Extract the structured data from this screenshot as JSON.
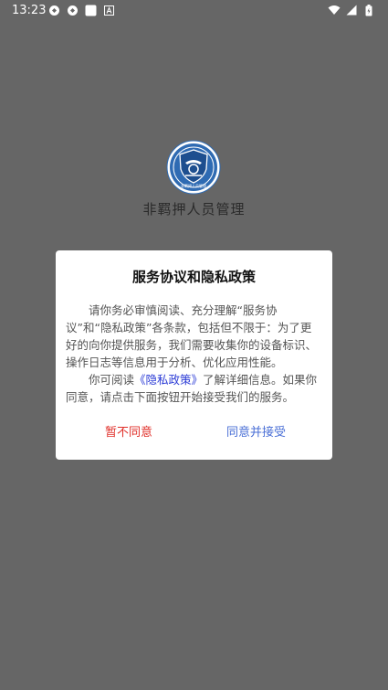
{
  "status_bar": {
    "time": "13:23",
    "left_icons": [
      "sync-icon",
      "sync-icon",
      "square-app-icon",
      "font-icon"
    ],
    "right_icons": [
      "wifi-icon",
      "signal-icon",
      "battery-icon"
    ]
  },
  "app": {
    "name": "非羁押人员管理",
    "logo_text": "非羁押人员管理"
  },
  "dialog": {
    "title": "服务协议和隐私政策",
    "paragraph1": "请你务必审慎阅读、充分理解“服务协议”和“隐私政策”各条款，包括但不限于：为了更好的向你提供服务，我们需要收集你的设备标识、操作日志等信息用于分析、优化应用性能。",
    "paragraph2_prefix": "你可阅读",
    "policy_link": "《隐私政策》",
    "paragraph2_suffix": "了解详细信息。如果你同意，请点击下面按钮开始接受我们的服务。",
    "disagree_label": "暂不同意",
    "agree_label": "同意并接受"
  },
  "colors": {
    "overlay_bg": "#666666",
    "disagree": "#e0302a",
    "agree": "#4a6fd6",
    "link": "#2b3bd6",
    "logo_blue": "#2f6bb3"
  }
}
